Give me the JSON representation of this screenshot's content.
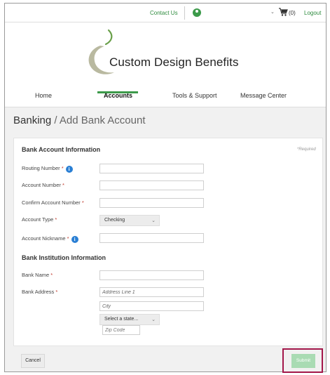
{
  "header": {
    "contact_label": "Contact Us",
    "cart_count": "(0)",
    "logout_label": "Logout",
    "accent_color": "#3c9a4a"
  },
  "brand": {
    "name": "Custom Design Benefits"
  },
  "nav": {
    "items": [
      {
        "label": "Home",
        "active": false
      },
      {
        "label": "Accounts",
        "active": true
      },
      {
        "label": "Tools & Support",
        "active": false
      },
      {
        "label": "Message Center",
        "active": false
      }
    ]
  },
  "page": {
    "title_main": "Banking",
    "title_sep": " / ",
    "title_sub": "Add Bank Account"
  },
  "form": {
    "required_note": "*Required",
    "section_account": "Bank Account Information",
    "section_institution": "Bank Institution Information",
    "routing_label": "Routing Number",
    "account_label": "Account Number",
    "confirm_label": "Confirm Account Number",
    "type_label": "Account Type",
    "type_value": "Checking",
    "nickname_label": "Account Nickname",
    "bank_name_label": "Bank Name",
    "bank_address_label": "Bank Address",
    "address_placeholder": "Address Line 1",
    "city_placeholder": "City",
    "state_value": "Select a state...",
    "zip_placeholder": "Zip Code",
    "required_mark": "*",
    "info_glyph": "i",
    "caret_glyph": "⌄"
  },
  "actions": {
    "cancel_label": "Cancel",
    "submit_label": "Submit",
    "highlight_color": "#a3174a"
  },
  "icons": [
    "user-icon",
    "cart-icon",
    "chevron-down-icon",
    "info-icon",
    "logo-swoosh-icon"
  ]
}
